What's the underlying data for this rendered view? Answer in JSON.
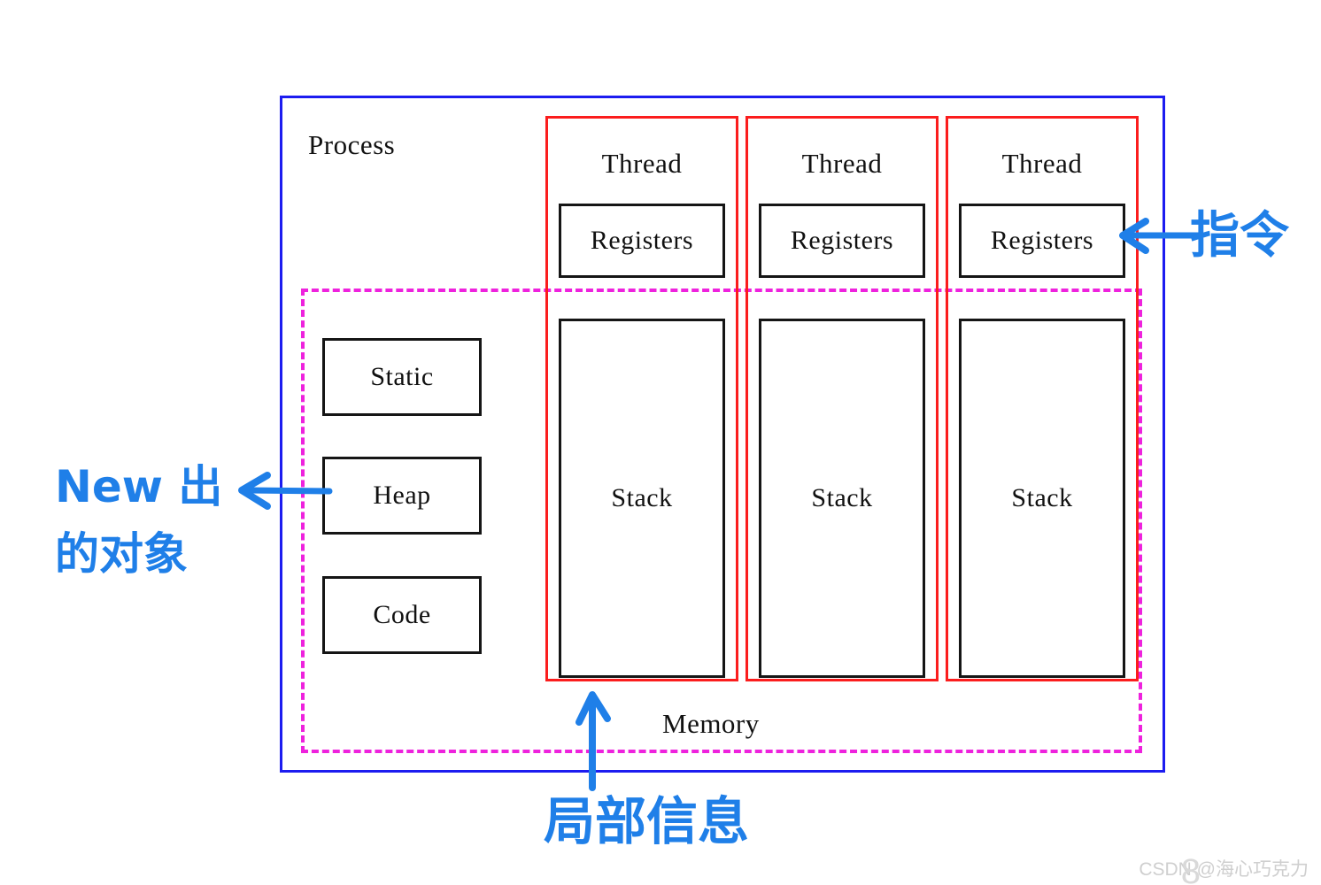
{
  "diagram": {
    "process": {
      "label": "Process",
      "border_color": "#1c1cf0"
    },
    "memory": {
      "label": "Memory",
      "border_color": "#ee22dd",
      "segments": [
        {
          "label": "Static"
        },
        {
          "label": "Heap"
        },
        {
          "label": "Code"
        }
      ]
    },
    "threads": {
      "border_color": "#fb1d1d",
      "columns": [
        {
          "title": "Thread",
          "registers": "Registers",
          "stack": "Stack"
        },
        {
          "title": "Thread",
          "registers": "Registers",
          "stack": "Stack"
        },
        {
          "title": "Thread",
          "registers": "Registers",
          "stack": "Stack"
        }
      ]
    },
    "annotations": {
      "ink_color": "#1f7fe8",
      "instruction": "指令",
      "new_object_line1": "New 出",
      "new_object_line2": "的对象",
      "local_info": "局部信息"
    }
  },
  "watermark": {
    "text": "CSDN @海心巧克力",
    "mark": "8"
  }
}
